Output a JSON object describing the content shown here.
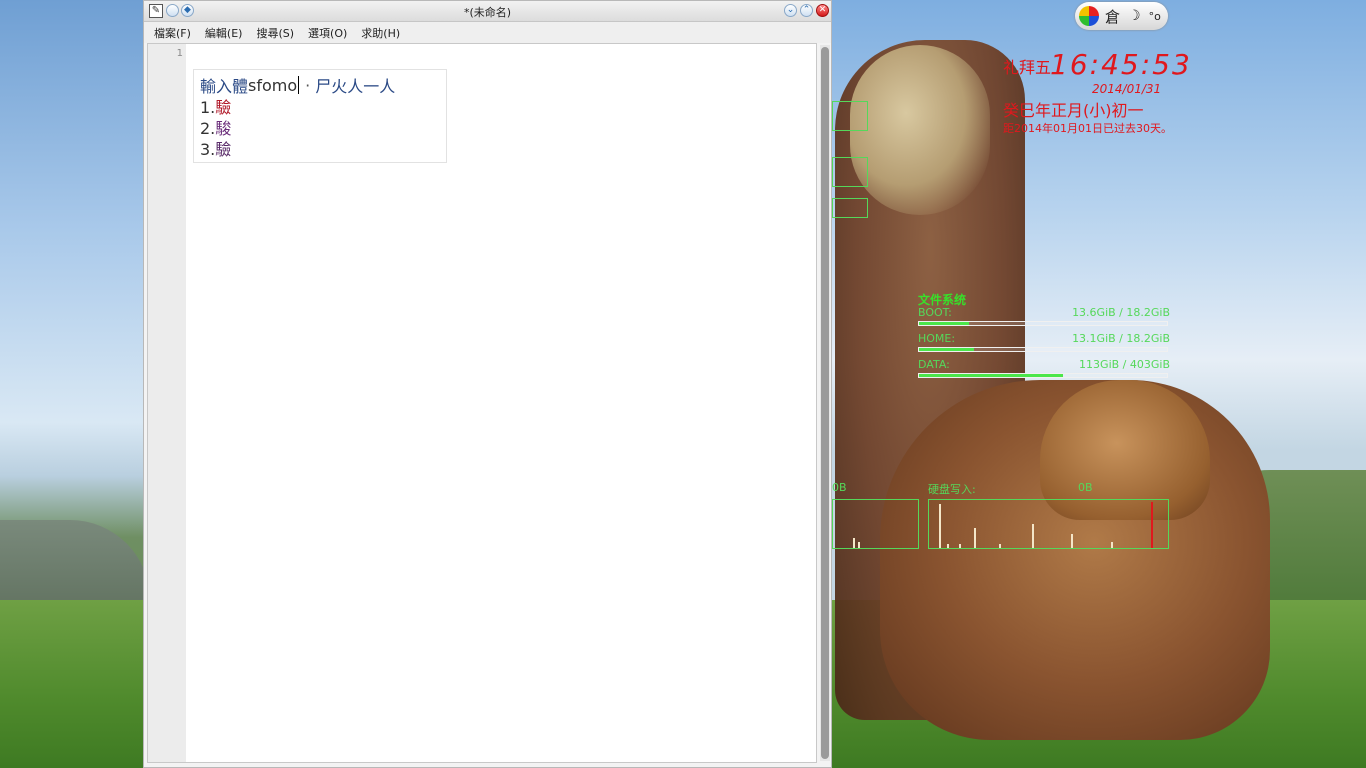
{
  "window": {
    "title": "*(未命名)",
    "menu": [
      "檔案(F)",
      "編輯(E)",
      "搜尋(S)",
      "選項(O)",
      "求助(H)"
    ],
    "line_number": "1"
  },
  "ime": {
    "prefix": "輸入體",
    "input": "sfomo",
    "separator": "·",
    "code": "尸火人一人",
    "candidates": [
      {
        "index": "1.",
        "char": "驗"
      },
      {
        "index": "2.",
        "char": "駿"
      },
      {
        "index": "3.",
        "char": "驗"
      }
    ]
  },
  "tray": {
    "ime_char": "倉",
    "moon": "☽",
    "punct": "°o"
  },
  "conky": {
    "weekday": "礼拜五",
    "time": "16:45:53",
    "date": "2014/01/31",
    "lunar": "癸巳年正月(小)初一",
    "elapsed": "距2014年01月01日已过去30天。",
    "fs_title": "文件系统",
    "fs": [
      {
        "label": "BOOT:",
        "value": "13.6GiB / 18.2GiB",
        "fill": 0.2
      },
      {
        "label": "HOME:",
        "value": "13.1GiB / 18.2GiB",
        "fill": 0.22
      },
      {
        "label": "DATA:",
        "value": "113GiB / 403GiB",
        "fill": 0.58
      }
    ],
    "disk_write_label": "硬盘写入:",
    "disk_write_value": "0B",
    "disk_read_value": "0B",
    "colors": {
      "clock": "#e0181d",
      "monitor": "#55d85a"
    }
  }
}
